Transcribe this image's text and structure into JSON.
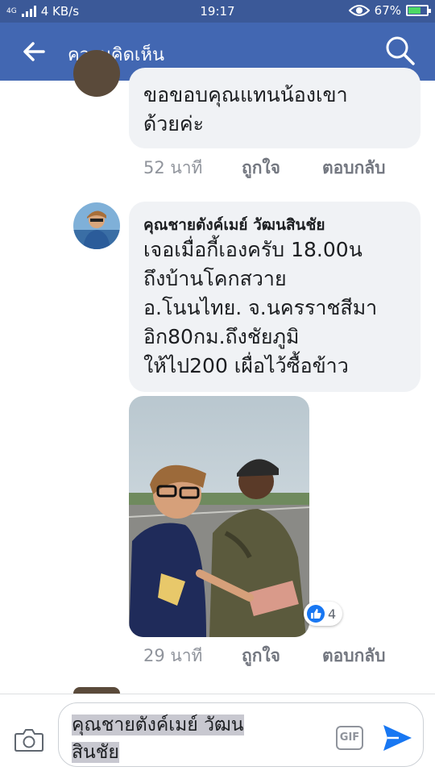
{
  "status_bar": {
    "network": "4G",
    "speed": "4 KB/s",
    "time": "19:17",
    "battery": "67%",
    "battery_level": 0.67
  },
  "header": {
    "title": "ความคิดเห็น",
    "back_icon": "arrow-left-icon",
    "search_icon": "search-icon"
  },
  "comments": [
    {
      "text_lines": [
        "ขอขอบคุณแทนน้องเขา",
        "ด้วยค่ะ"
      ],
      "time": "52 นาที",
      "like": "ถูกใจ",
      "reply": "ตอบกลับ"
    },
    {
      "author": "คุณชายตังค์เมย์ วัฒนสินชัย",
      "text_lines": [
        "เจอเมื่อกี้เองครับ 18.00น",
        "ถึงบ้านโคกสวาย",
        "อ.โนนไทย. จ.นครราชสีมา",
        "อิก80กม.ถึงชัยภูมิ",
        "ให้ไป200 เผื่อไว้ซื้อข้าว"
      ],
      "reaction_count": "4",
      "time": "29 นาที",
      "like": "ถูกใจ",
      "reply": "ตอบกลับ"
    }
  ],
  "composer": {
    "text_lines": [
      "คุณชายตังค์เมย์ วัฒน",
      "สินชัย"
    ],
    "gif_label": "GIF",
    "camera_icon": "camera-icon",
    "send_icon": "send-icon"
  },
  "colors": {
    "header": "#4267b2",
    "status_bar": "#3b5998",
    "bubble": "#f0f2f5",
    "accent": "#1877f2"
  }
}
